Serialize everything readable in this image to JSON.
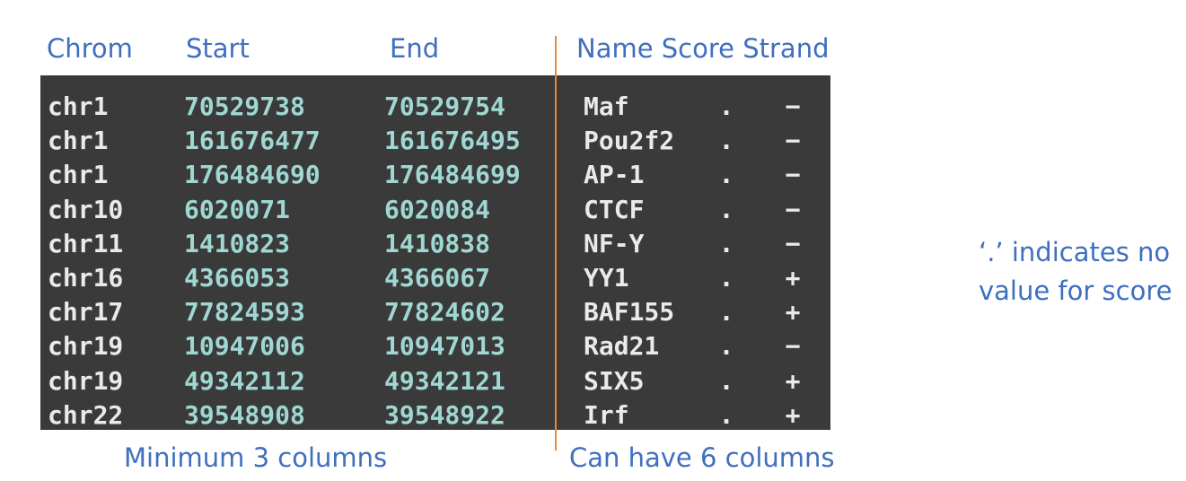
{
  "headers": {
    "chrom": "Chrom",
    "start": "Start",
    "end": "End",
    "name_score_strand": "Name Score Strand"
  },
  "rows": [
    {
      "chrom": "chr1",
      "start": "70529738",
      "end": "70529754",
      "name": "Maf",
      "score": ".",
      "strand": "−"
    },
    {
      "chrom": "chr1",
      "start": "161676477",
      "end": "161676495",
      "name": "Pou2f2",
      "score": ".",
      "strand": "−"
    },
    {
      "chrom": "chr1",
      "start": "176484690",
      "end": "176484699",
      "name": "AP-1",
      "score": ".",
      "strand": "−"
    },
    {
      "chrom": "chr10",
      "start": "6020071",
      "end": "6020084",
      "name": "CTCF",
      "score": ".",
      "strand": "−"
    },
    {
      "chrom": "chr11",
      "start": "1410823",
      "end": "1410838",
      "name": "NF-Y",
      "score": ".",
      "strand": "−"
    },
    {
      "chrom": "chr16",
      "start": "4366053",
      "end": "4366067",
      "name": "YY1",
      "score": ".",
      "strand": "+"
    },
    {
      "chrom": "chr17",
      "start": "77824593",
      "end": "77824602",
      "name": "BAF155",
      "score": ".",
      "strand": "+"
    },
    {
      "chrom": "chr19",
      "start": "10947006",
      "end": "10947013",
      "name": "Rad21",
      "score": ".",
      "strand": "−"
    },
    {
      "chrom": "chr19",
      "start": "49342112",
      "end": "49342121",
      "name": "SIX5",
      "score": ".",
      "strand": "+"
    },
    {
      "chrom": "chr22",
      "start": "39548908",
      "end": "39548922",
      "name": "Irf",
      "score": ".",
      "strand": "+"
    }
  ],
  "footer": {
    "left": "Minimum 3 columns",
    "right": "Can have 6 columns"
  },
  "note": {
    "line1": "‘.’ indicates no",
    "line2": "value for score"
  },
  "colors": {
    "label_blue": "#3f6fbf",
    "divider_orange": "#e8893a",
    "terminal_bg": "#3a3a3a",
    "coord_teal": "#9fd7d2",
    "text_light": "#eaeaea"
  }
}
